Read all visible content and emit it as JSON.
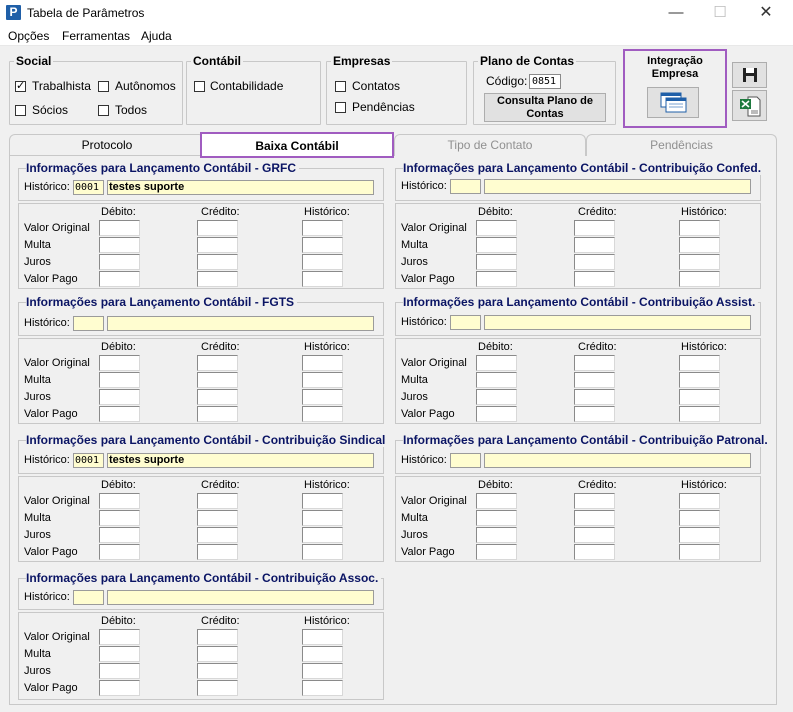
{
  "window": {
    "title": "Tabela de Parâmetros",
    "minimize": "—",
    "maximize": "☐",
    "close": "✕"
  },
  "menu": [
    "Opções",
    "Ferramentas",
    "Ajuda"
  ],
  "social": {
    "title": "Social",
    "items": [
      {
        "label": "Trabalhista",
        "checked": true
      },
      {
        "label": "Autônomos",
        "checked": false
      },
      {
        "label": "Sócios",
        "checked": false
      },
      {
        "label": "Todos",
        "checked": false
      }
    ]
  },
  "contabil": {
    "title": "Contábil",
    "items": [
      {
        "label": "Contabilidade",
        "checked": false
      }
    ]
  },
  "empresas": {
    "title": "Empresas",
    "items": [
      {
        "label": "Contatos",
        "checked": false
      },
      {
        "label": "Pendências",
        "checked": false
      }
    ]
  },
  "plano": {
    "title": "Plano de Contas",
    "codigo_label": "Código:",
    "codigo_value": "0851",
    "button_label": "Consulta Plano de Contas"
  },
  "integracao": {
    "title": "Integração Empresa"
  },
  "tabs": [
    {
      "label": "Protocolo",
      "state": "normal"
    },
    {
      "label": "Baixa Contábil",
      "state": "active"
    },
    {
      "label": "Tipo de Contato",
      "state": "disabled"
    },
    {
      "label": "Pendências",
      "state": "disabled"
    }
  ],
  "labels": {
    "historico": "Histórico:",
    "debito": "Débito:",
    "credito": "Crédito:",
    "historico_col": "Histórico:",
    "rows": [
      "Valor Original",
      "Multa",
      "Juros",
      "Valor Pago"
    ]
  },
  "sections": {
    "grfc": {
      "title": "Informações para Lançamento Contábil - GRFC",
      "code": "0001",
      "desc": "testes suporte"
    },
    "fgts": {
      "title": "Informações para Lançamento Contábil - FGTS",
      "code": "",
      "desc": ""
    },
    "sindical": {
      "title": "Informações para Lançamento Contábil - Contribuição Sindical",
      "code": "0001",
      "desc": "testes suporte"
    },
    "assoc": {
      "title": "Informações para Lançamento Contábil - Contribuição Assoc.",
      "code": "",
      "desc": ""
    },
    "confed": {
      "title": "Informações para Lançamento Contábil - Contribuição Confed.",
      "code": "",
      "desc": ""
    },
    "assist": {
      "title": "Informações para Lançamento Contábil - Contribuição Assist.",
      "code": "",
      "desc": ""
    },
    "patronal": {
      "title": "Informações para Lançamento Contábil - Contribuição Patronal.",
      "code": "",
      "desc": ""
    }
  }
}
